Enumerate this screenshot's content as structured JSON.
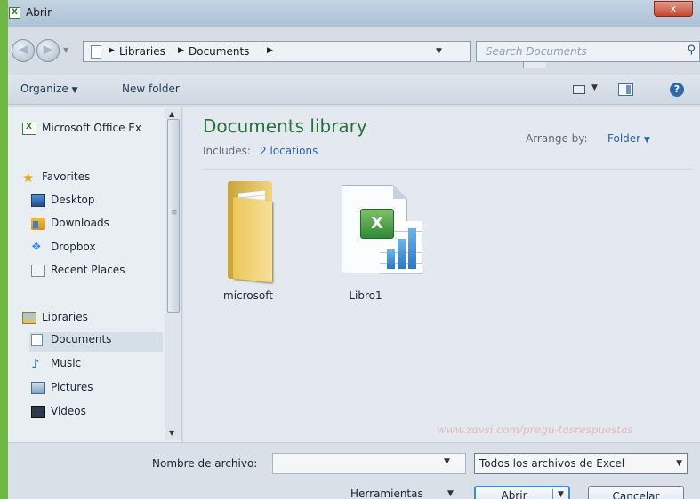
{
  "window": {
    "title": "Abrir",
    "close_glyph": "x"
  },
  "address": {
    "crumbs": [
      "Libraries",
      "Documents"
    ],
    "search_placeholder": "Search Documents"
  },
  "toolbar": {
    "organize": "Organize",
    "new_folder": "New folder",
    "help": "?"
  },
  "sidebar": {
    "items": [
      {
        "label": "Microsoft Office Ex",
        "icon": "excel-icon"
      },
      {
        "label": "Favorites",
        "icon": "star-icon"
      },
      {
        "label": "Desktop",
        "icon": "desktop-icon"
      },
      {
        "label": "Downloads",
        "icon": "downloads-icon"
      },
      {
        "label": "Dropbox",
        "icon": "dropbox-icon"
      },
      {
        "label": "Recent Places",
        "icon": "recent-places-icon"
      },
      {
        "label": "Libraries",
        "icon": "libraries-icon"
      },
      {
        "label": "Documents",
        "icon": "documents-icon",
        "selected": true
      },
      {
        "label": "Music",
        "icon": "music-icon"
      },
      {
        "label": "Pictures",
        "icon": "pictures-icon"
      },
      {
        "label": "Videos",
        "icon": "videos-icon"
      }
    ]
  },
  "main": {
    "title": "Documents library",
    "includes_label": "Includes:",
    "includes_link": "2 locations",
    "arrange_label": "Arrange by:",
    "arrange_value": "Folder",
    "files": [
      {
        "name": "microsoft",
        "icon": "folder-icon"
      },
      {
        "name": "Libro1",
        "icon": "excel-file-icon"
      }
    ],
    "watermark": "www.zavsi.com/pregu-tasrespuestas"
  },
  "bottom": {
    "filename_label": "Nombre de archivo:",
    "filename_value": "",
    "filter_value": "Todos los archivos de Excel",
    "tools_label": "Herramientas",
    "open_label": "Abrir",
    "cancel_label": "Cancelar"
  },
  "colors": {
    "background_green": "#6fb844",
    "library_title": "#2a6f3f",
    "link_blue": "#2a63a6"
  }
}
